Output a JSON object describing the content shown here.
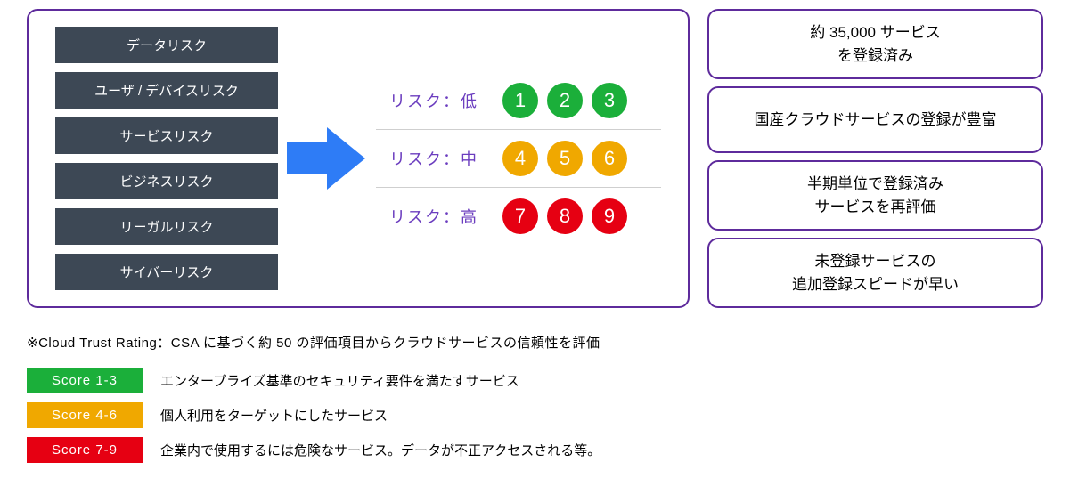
{
  "risk_categories": [
    "データリスク",
    "ユーザ / デバイスリスク",
    "サービスリスク",
    "ビジネスリスク",
    "リーガルリスク",
    "サイバーリスク"
  ],
  "rating_rows": [
    {
      "label": "リスク：低",
      "color": "green",
      "nums": [
        "1",
        "2",
        "3"
      ]
    },
    {
      "label": "リスク：中",
      "color": "amber",
      "nums": [
        "4",
        "5",
        "6"
      ]
    },
    {
      "label": "リスク：高",
      "color": "red",
      "nums": [
        "7",
        "8",
        "9"
      ]
    }
  ],
  "side_boxes": [
    {
      "line1": "約 35,000 サービス",
      "line2": "を登録済み"
    },
    {
      "line1": "国産クラウドサービスの登録が豊富",
      "line2": ""
    },
    {
      "line1": "半期単位で登録済み",
      "line2": "サービスを再評価"
    },
    {
      "line1": "未登録サービスの",
      "line2": "追加登録スピードが早い"
    }
  ],
  "footnote": "※Cloud Trust Rating：CSA に基づく約 50 の評価項目からクラウドサービスの信頼性を評価",
  "legend": [
    {
      "tag": "Score 1-3",
      "color": "green",
      "desc": "エンタープライズ基準のセキュリティ要件を満たすサービス"
    },
    {
      "tag": "Score 4-6",
      "color": "amber",
      "desc": "個人利用をターゲットにしたサービス"
    },
    {
      "tag": "Score 7-9",
      "color": "red",
      "desc": "企業内で使用するには危険なサービス。データが不正アクセスされる等。"
    }
  ],
  "colors": {
    "green": "#1BAF3A",
    "amber": "#F0A800",
    "red": "#E60012",
    "purple": "#5E2B9C",
    "slate": "#3D4855",
    "arrow": "#2E7CF6"
  }
}
